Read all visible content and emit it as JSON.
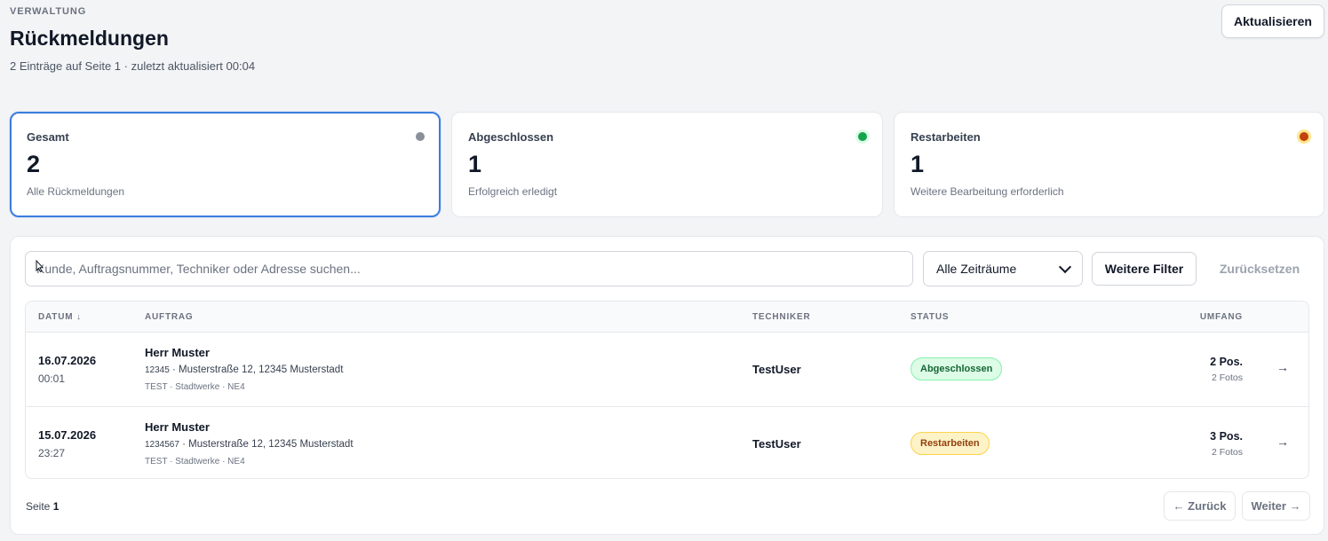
{
  "header": {
    "overline": "VERWALTUNG",
    "title": "Rückmeldungen",
    "subtitle": "2 Einträge auf Seite 1 · zuletzt aktualisiert 00:04",
    "refresh_label": "Aktualisieren"
  },
  "stats": [
    {
      "label": "Gesamt",
      "value": "2",
      "description": "Alle Rückmeldungen",
      "dot_color": "#8b8f9a",
      "active": true
    },
    {
      "label": "Abgeschlossen",
      "value": "1",
      "description": "Erfolgreich erledigt",
      "dot_color": "#16a34a",
      "active": false
    },
    {
      "label": "Restarbeiten",
      "value": "1",
      "description": "Weitere Bearbeitung erforderlich",
      "dot_color": "#d97706",
      "active": false
    }
  ],
  "filters": {
    "search_placeholder": "Kunde, Auftragsnummer, Techniker oder Adresse suchen...",
    "period_selected": "Alle Zeiträume",
    "more_filters_label": "Weitere Filter",
    "reset_label": "Zurücksetzen"
  },
  "table": {
    "columns": {
      "date": "DATUM ↓",
      "order": "AUFTRAG",
      "technician": "TECHNIKER",
      "status": "STATUS",
      "scope": "UMFANG"
    },
    "rows": [
      {
        "date": "16.07.2026",
        "time": "00:01",
        "customer": "Herr Muster",
        "order_number": "12345",
        "address": " · Musterstraße 12, 12345 Musterstadt",
        "meta": "TEST · Stadtwerke · NE4",
        "technician": "TestUser",
        "status": "Abgeschlossen",
        "status_variant": "green",
        "positions": "2 Pos.",
        "photos": "2 Fotos",
        "arrow": "→"
      },
      {
        "date": "15.07.2026",
        "time": "23:27",
        "customer": "Herr Muster",
        "order_number": "1234567",
        "address": " · Musterstraße 12, 12345 Musterstadt",
        "meta": "TEST · Stadtwerke · NE4",
        "technician": "TestUser",
        "status": "Restarbeiten",
        "status_variant": "yellow",
        "positions": "3 Pos.",
        "photos": "2 Fotos",
        "arrow": "→"
      }
    ]
  },
  "pagination": {
    "page_label": "Seite",
    "page_number": "1",
    "prev_label": "← Zurück",
    "next_label": "Weiter →"
  },
  "colors": {
    "accent": "#3b7ddd",
    "background": "#f3f4f6",
    "success_bg": "#dcfce7",
    "warning_bg": "#fef3c7"
  }
}
